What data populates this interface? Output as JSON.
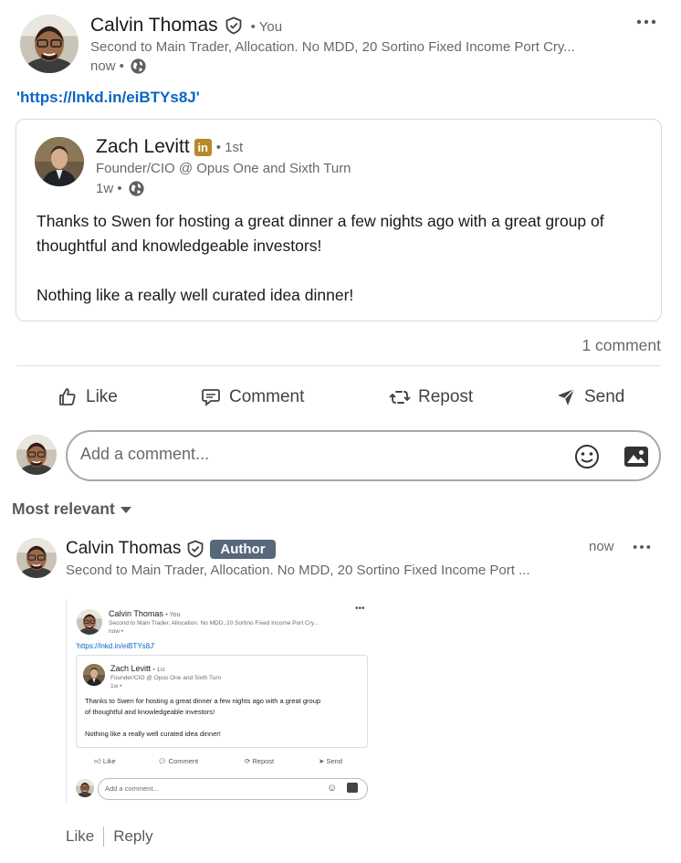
{
  "post": {
    "author_name": "Calvin Thomas",
    "author_relation": "• You",
    "author_headline": "Second to Main Trader, Allocation. No MDD, 20 Sortino Fixed Income Port Cry...",
    "time": "now •",
    "link_text": "'https://lnkd.in/eiBTYs8J'",
    "more_icon": "ellipsis-icon"
  },
  "quoted": {
    "author_name": "Zach Levitt",
    "degree": "• 1st",
    "headline": "Founder/CIO @ Opus One and Sixth Turn",
    "time": "1w •",
    "paragraph1": "Thanks to Swen for hosting a great dinner a few nights ago with a great group of thoughtful and knowledgeable investors!",
    "paragraph2": "Nothing like a really well curated idea dinner!"
  },
  "social": {
    "comment_count": "1 comment"
  },
  "actions": {
    "like": "Like",
    "comment": "Comment",
    "repost": "Repost",
    "send": "Send"
  },
  "composer": {
    "placeholder": "Add a comment..."
  },
  "sort": {
    "label": "Most relevant"
  },
  "comment": {
    "author_name": "Calvin Thomas",
    "badge": "Author",
    "headline": "Second to Main Trader, Allocation. No MDD, 20 Sortino Fixed Income Port ...",
    "time": "now",
    "like": "Like",
    "reply": "Reply"
  },
  "mini": {
    "author_name": "Calvin Thomas",
    "author_relation": "• You",
    "author_headline": "Second to Main Trader, Allocation. No MDD, 20 Sortino Fixed Income Port Cry...",
    "time": "now •",
    "link_text": "'https://lnkd.in/eiBTYs8J'",
    "quoted_name": "Zach Levitt",
    "quoted_degree": "• 1st",
    "quoted_headline": "Founder/CIO @ Opus One and Sixth Turn",
    "quoted_time": "1w •",
    "para1_line1": "Thanks to Swen for hosting a great dinner a few nights ago with a great group",
    "para1_line2": "of thoughtful and knowledgeable investors!",
    "para2": "Nothing like a really well curated idea dinner!",
    "like": "Like",
    "comment": "Comment",
    "repost": "Repost",
    "send": "Send",
    "placeholder": "Add a comment..."
  },
  "colors": {
    "link": "#0a66c2",
    "badge_bg": "#56687a",
    "linkedin_badge": "#b8892a"
  }
}
